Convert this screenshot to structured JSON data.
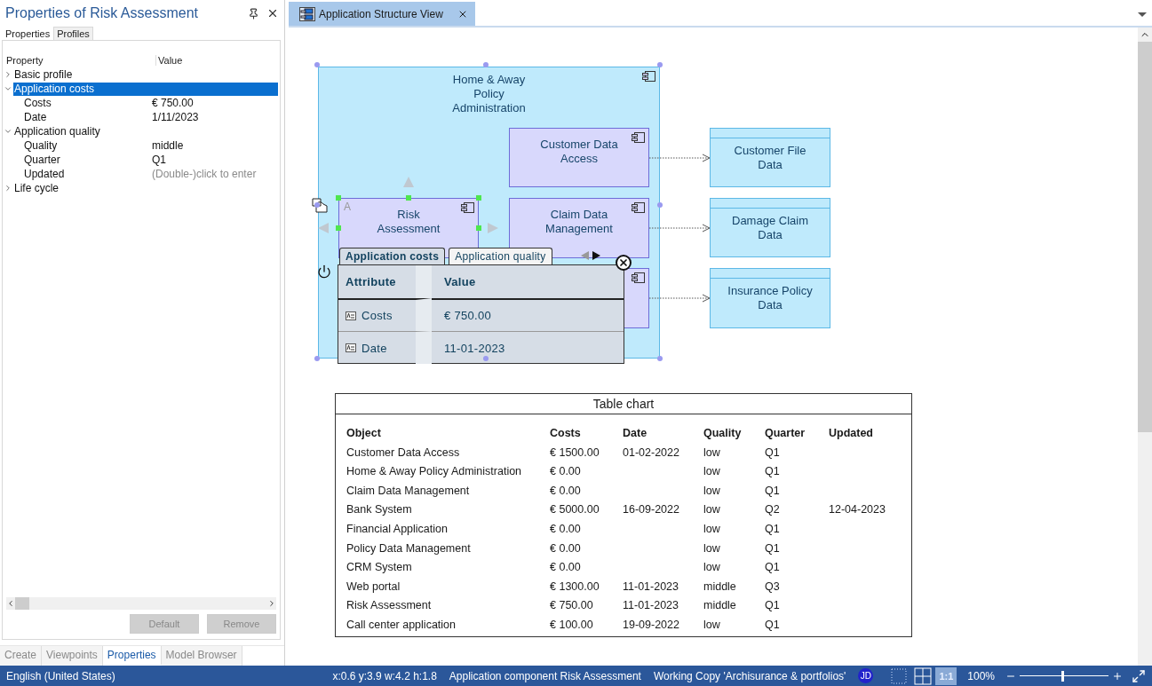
{
  "properties_panel": {
    "title": "Properties of Risk Assessment",
    "tabs": [
      {
        "label": "Properties",
        "selected": true
      },
      {
        "label": "Profiles",
        "selected": false
      }
    ],
    "columns": [
      "Property",
      "Value"
    ],
    "tree": [
      {
        "label": "Basic profile",
        "expanded": false,
        "selected": false
      },
      {
        "label": "Application costs",
        "expanded": true,
        "selected": true,
        "children": [
          {
            "label": "Costs",
            "value": "€ 750.00",
            "selected": false
          },
          {
            "label": "Date",
            "value": "1/11/2023",
            "selected": false
          }
        ]
      },
      {
        "label": "Application quality",
        "expanded": true,
        "selected": false,
        "children": [
          {
            "label": "Quality",
            "value": "middle",
            "selected": false
          },
          {
            "label": "Quarter",
            "value": "Q1",
            "selected": false
          },
          {
            "label": "Updated",
            "placeholder": "(Double-)click to enter",
            "selected": false
          }
        ]
      },
      {
        "label": "Life cycle",
        "expanded": false,
        "selected": false
      }
    ],
    "buttons": [
      {
        "label": "Default",
        "disabled": true
      },
      {
        "label": "Remove",
        "disabled": true
      }
    ],
    "bottom_tabs": [
      {
        "label": "Create",
        "selected": false
      },
      {
        "label": "Viewpoints",
        "selected": false
      },
      {
        "label": "Properties",
        "selected": true
      },
      {
        "label": "Model Browser",
        "selected": false
      }
    ]
  },
  "document_tabs": [
    {
      "label": "Application Structure View",
      "selected": true
    }
  ],
  "diagram": {
    "container": {
      "label": "Home & Away Policy Administration",
      "selected": true
    },
    "nodes": [
      {
        "kind": "component",
        "label": "Customer Data Access",
        "selected": false
      },
      {
        "kind": "component",
        "label": "Risk Assessment",
        "marker": "A",
        "selected": true
      },
      {
        "kind": "component",
        "label": "Claim Data Management",
        "selected": false
      },
      {
        "kind": "component",
        "selected": false
      },
      {
        "kind": "data",
        "label": "Customer File Data",
        "selected": false
      },
      {
        "kind": "data",
        "label": "Damage Claim Data",
        "selected": false
      },
      {
        "kind": "data",
        "label": "Insurance Policy Data",
        "selected": false
      }
    ],
    "popup": {
      "tabs": [
        {
          "label": "Application costs",
          "selected": true
        },
        {
          "label": "Application quality",
          "selected": false
        }
      ],
      "columns": [
        "Attribute",
        "Value"
      ],
      "rows": [
        {
          "attribute": "Costs",
          "value": "€ 750.00"
        },
        {
          "attribute": "Date",
          "value": "11-01-2023"
        }
      ]
    },
    "table_chart": {
      "title": "Table chart",
      "columns": [
        "Object",
        "Costs",
        "Date",
        "Quality",
        "Quarter",
        "Updated"
      ],
      "rows": [
        [
          "Customer Data Access",
          "€ 1500.00",
          "01-02-2022",
          "low",
          "Q1",
          null
        ],
        [
          "Home & Away Policy Administration",
          "€ 0.00",
          null,
          "low",
          "Q1",
          null
        ],
        [
          "Claim Data Management",
          "€ 0.00",
          null,
          "low",
          "Q1",
          null
        ],
        [
          "Bank System",
          "€ 5000.00",
          "16-09-2022",
          "low",
          "Q2",
          "12-04-2023"
        ],
        [
          "Financial Application",
          "€ 0.00",
          null,
          "low",
          "Q1",
          null
        ],
        [
          "Policy Data Management",
          "€ 0.00",
          null,
          "low",
          "Q1",
          null
        ],
        [
          "CRM System",
          "€ 0.00",
          null,
          "low",
          "Q1",
          null
        ],
        [
          "Web portal",
          "€ 1300.00",
          "11-01-2023",
          "middle",
          "Q3",
          null
        ],
        [
          "Risk Assessment",
          "€ 750.00",
          "11-01-2023",
          "middle",
          "Q1",
          null
        ],
        [
          "Call center application",
          "€ 100.00",
          "19-09-2022",
          "low",
          "Q1",
          null
        ]
      ]
    }
  },
  "status_bar": {
    "language": "English (United States)",
    "geometry": "x:0.6 y:3.9 w:4.2 h:1.8",
    "element": "Application component Risk Assessment",
    "working_copy": "Working Copy 'Archisurance & portfolios'",
    "user": "JD",
    "scale_button": {
      "label": "1:1",
      "selected": true
    },
    "zoom": "100%",
    "zoom_slider": {
      "level": 0.47
    }
  }
}
